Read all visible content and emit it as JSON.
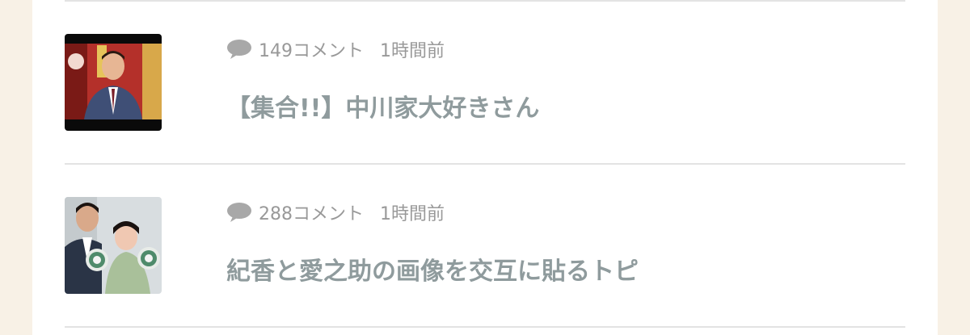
{
  "topics": [
    {
      "comment_count": "149コメント",
      "time": "1時間前",
      "title": "【集合!!】中川家大好きさん",
      "thumbnail_icon": "tv-studio-photo"
    },
    {
      "comment_count": "288コメント",
      "time": "1時間前",
      "title": "紀香と愛之助の画像を交互に貼るトピ",
      "thumbnail_icon": "couple-photo"
    }
  ],
  "colors": {
    "page_background": "#f8f1e6",
    "panel_background": "#ffffff",
    "divider": "#e3e3e3",
    "meta_text": "#999999",
    "title_text": "#8f9b9d"
  }
}
